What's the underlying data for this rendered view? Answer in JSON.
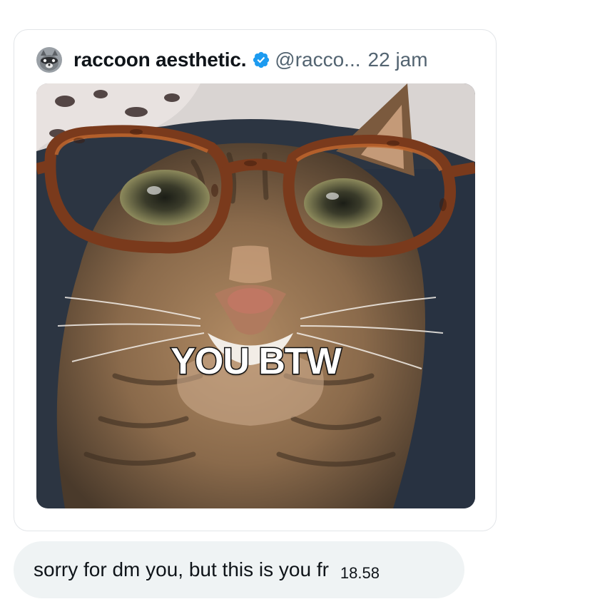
{
  "shared_post": {
    "author_name": "raccoon aesthetic.",
    "handle": "@racco...",
    "separator": "",
    "time": "22 jam",
    "verified": true,
    "media": {
      "caption": "YOU BTW"
    }
  },
  "message": {
    "text": "sorry for dm you, but this is you fr",
    "time": "18.58"
  },
  "colors": {
    "bubble_bg": "#eff3f4",
    "verified_blue": "#1d9bf0",
    "secondary_text": "#536471",
    "card_border": "#e2e5e8"
  },
  "icons": {
    "avatar": "raccoon-avatar",
    "verified": "verified-badge-icon"
  }
}
